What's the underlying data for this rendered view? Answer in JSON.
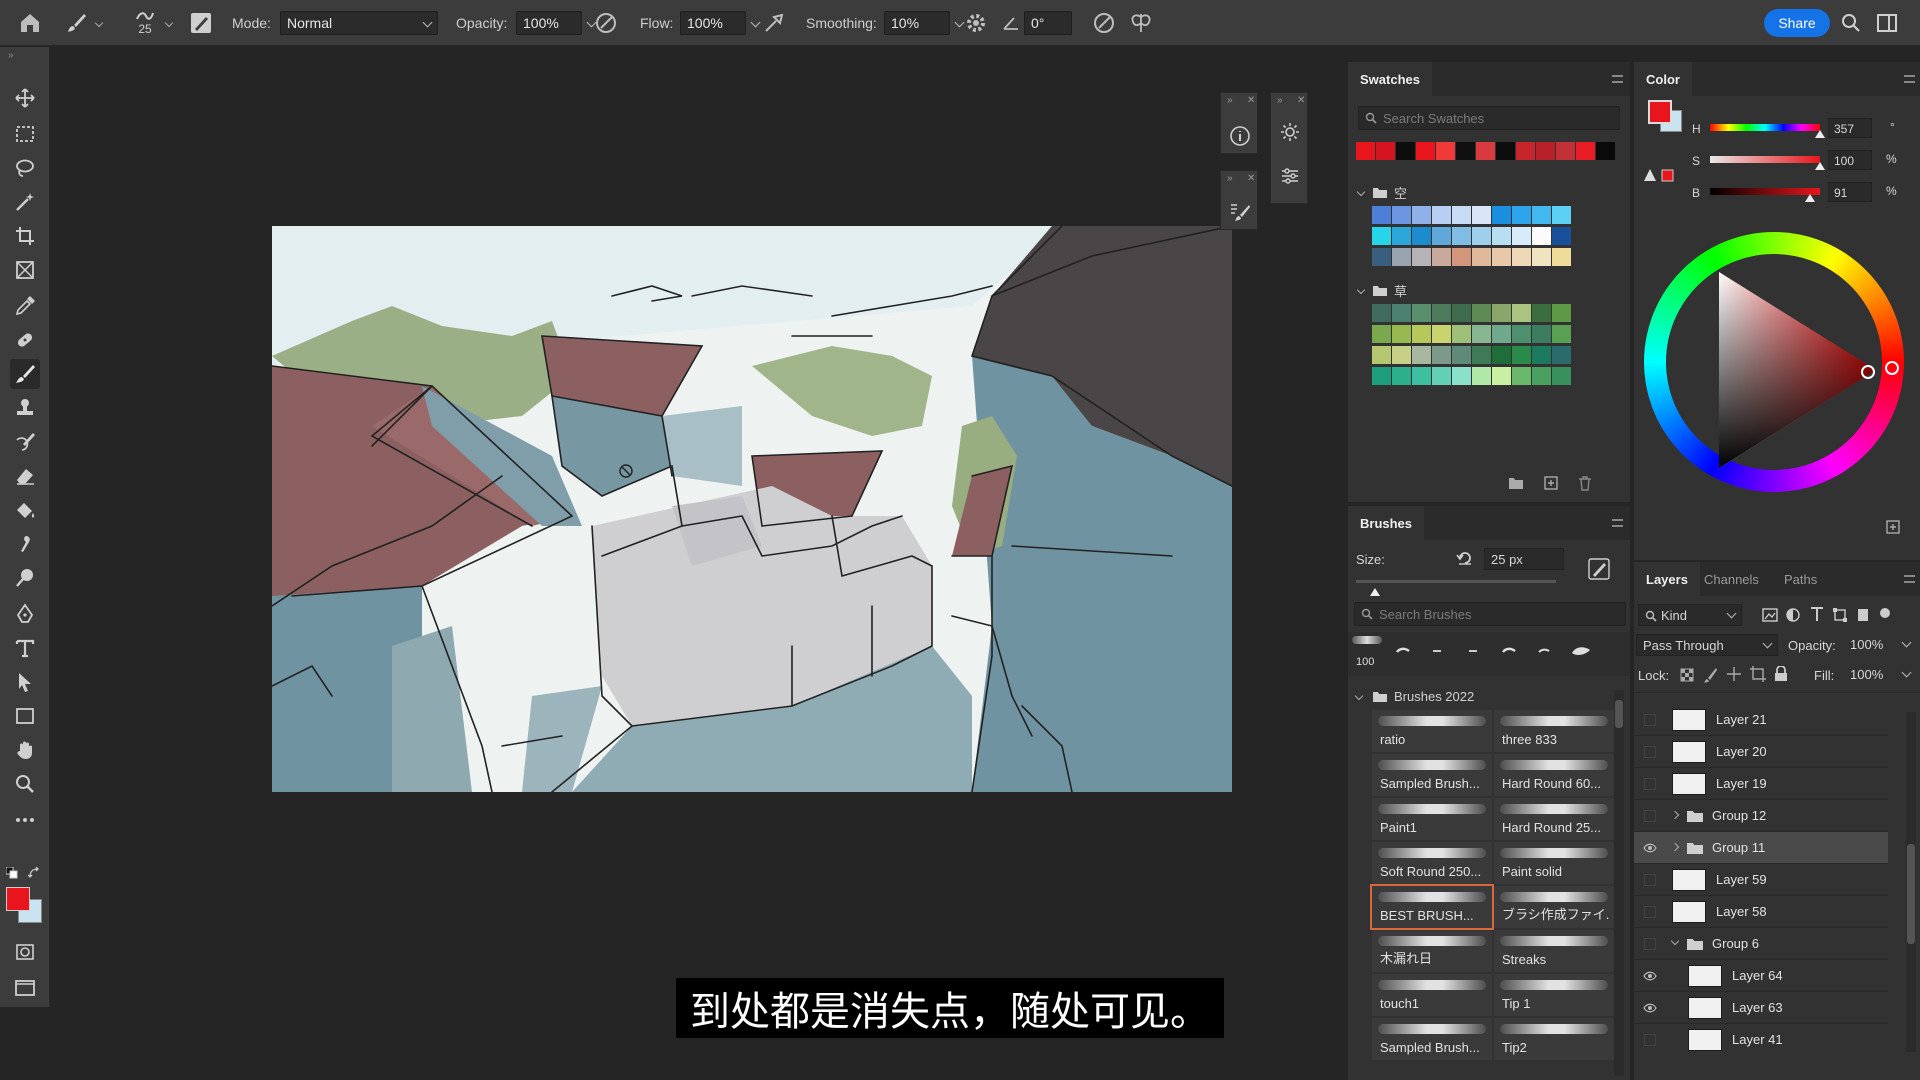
{
  "options_bar": {
    "brush_size": "25",
    "mode_label": "Mode:",
    "mode_value": "Normal",
    "opacity_label": "Opacity:",
    "opacity_value": "100%",
    "flow_label": "Flow:",
    "flow_value": "100%",
    "smoothing_label": "Smoothing:",
    "smoothing_value": "10%",
    "angle_value": "0°",
    "share_label": "Share"
  },
  "toolbar": {
    "tools": [
      "move-icon",
      "marquee-icon",
      "lasso-icon",
      "magic-wand-icon",
      "crop-icon",
      "frame-icon",
      "eyedropper-icon",
      "healing-brush-icon",
      "brush-icon",
      "stamp-icon",
      "history-brush-icon",
      "eraser-icon",
      "paint-bucket-icon",
      "smudge-icon",
      "dodge-icon",
      "pen-icon",
      "type-icon",
      "path-select-icon",
      "rectangle-icon",
      "hand-icon",
      "zoom-icon",
      "more-icon"
    ],
    "active_tool": "brush-icon",
    "foreground_color": "#e8161c",
    "background_color": "#c9e3f0"
  },
  "swatches": {
    "title": "Swatches",
    "search_placeholder": "Search Swatches",
    "recent": [
      "#e8161c",
      "#d41420",
      "#0d0d0d",
      "#e8161c",
      "#f03a3a",
      "#101010",
      "#d93a40",
      "#0d0d0d",
      "#c8242c",
      "#b8202a",
      "#c23038",
      "#e81c24",
      "#0a0a0a"
    ],
    "folders": [
      {
        "name": "空",
        "colors": [
          "#4e7fd8",
          "#6b95e0",
          "#8fb0e8",
          "#b7cff2",
          "#c8dcf5",
          "#d8e6f8",
          "#1a8fe0",
          "#2ea4ec",
          "#41b8f0",
          "#5cd0f5",
          "#27d4ea",
          "#2aa7d8",
          "#1c8ccd",
          "#5fa8d9",
          "#7fbde4",
          "#9ecfec",
          "#b8def2",
          "#d7ecf8",
          "#fbfbfb",
          "#1a4f9c",
          "#3a5f7e",
          "#9aa3b0",
          "#b7b2b6",
          "#c9a99c",
          "#d4967a",
          "#e0b89a",
          "#e8c8a8",
          "#eed8b8",
          "#f0e4c0",
          "#f0dc9a"
        ]
      },
      {
        "name": "草",
        "colors": [
          "#3f6c5e",
          "#4b8070",
          "#5a8f6e",
          "#4c7a5a",
          "#3e6b4c",
          "#5d8a55",
          "#8aa66b",
          "#a9c47e",
          "#3a6e3e",
          "#5e9a45",
          "#7aa84d",
          "#98b850",
          "#b7c85a",
          "#c9d46e",
          "#9fc078",
          "#87b690",
          "#6fa88c",
          "#4d9070",
          "#3c7c60",
          "#58a052",
          "#b5c870",
          "#c8d088",
          "#a8b8a0",
          "#7c9a8a",
          "#5e8a7a",
          "#3e7a56",
          "#1f6e3a",
          "#2a8a4a",
          "#1c7a5e",
          "#2a6c6c",
          "#1c9e7c",
          "#2cb08c",
          "#3cc0a0",
          "#62d0b4",
          "#8ae0c8",
          "#b0e8a8",
          "#c8f0a0",
          "#6ab86c",
          "#4aa060",
          "#38905a"
        ]
      }
    ]
  },
  "color": {
    "title": "Color",
    "h_label": "H",
    "h_value": "357",
    "h_unit": "°",
    "s_label": "S",
    "s_value": "100",
    "s_unit": "%",
    "b_label": "B",
    "b_value": "91",
    "b_unit": "%",
    "current": "#e8161c"
  },
  "brushes": {
    "title": "Brushes",
    "size_label": "Size:",
    "size_value": "25 px",
    "search_placeholder": "Search Brushes",
    "preset_size": "100",
    "folder_name": "Brushes 2022",
    "items": [
      "ratio",
      "three 833",
      "Sampled Brush...",
      "Hard Round 60...",
      "Paint1",
      "Hard Round 25...",
      "Soft Round 250...",
      "Paint solid",
      "BEST BRUSH...",
      "ブラシ作成ファイ...",
      "木漏れ日",
      "Streaks",
      "touch1",
      "Tip 1",
      "Sampled Brush...",
      "Tip2"
    ],
    "selected_index": 8
  },
  "layers": {
    "tabs": [
      "Layers",
      "Channels",
      "Paths"
    ],
    "filter_label": "Kind",
    "blend_mode": "Pass Through",
    "opacity_label": "Opacity:",
    "opacity_value": "100%",
    "lock_label": "Lock:",
    "fill_label": "Fill:",
    "fill_value": "100%",
    "rows": [
      {
        "name": "Layer 21",
        "type": "layer",
        "visible": false,
        "indent": 0
      },
      {
        "name": "Layer 20",
        "type": "layer",
        "visible": false,
        "indent": 0
      },
      {
        "name": "Layer 19",
        "type": "layer",
        "visible": false,
        "indent": 0
      },
      {
        "name": "Group 12",
        "type": "group",
        "visible": false,
        "indent": 0,
        "open": false
      },
      {
        "name": "Group 11",
        "type": "group",
        "visible": true,
        "indent": 0,
        "open": false,
        "selected": true
      },
      {
        "name": "Layer 59",
        "type": "layer",
        "visible": false,
        "indent": 0
      },
      {
        "name": "Layer 58",
        "type": "layer",
        "visible": false,
        "indent": 0
      },
      {
        "name": "Group 6",
        "type": "group",
        "visible": false,
        "indent": 0,
        "open": true
      },
      {
        "name": "Layer 64",
        "type": "layer",
        "visible": true,
        "indent": 1
      },
      {
        "name": "Layer 63",
        "type": "layer",
        "visible": true,
        "indent": 1
      },
      {
        "name": "Layer 41",
        "type": "layer",
        "visible": false,
        "indent": 1
      }
    ]
  },
  "subtitle": "到处都是消失点，随处可见。"
}
